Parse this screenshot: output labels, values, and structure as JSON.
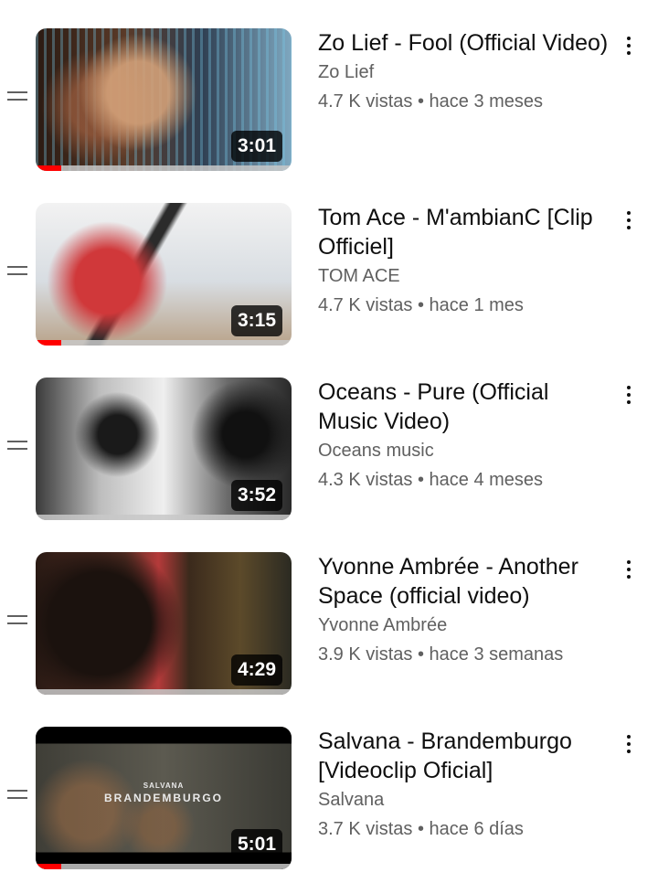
{
  "videos": [
    {
      "title": "Zo Lief - Fool (Official Video)",
      "channel": "Zo Lief",
      "views": "4.7 K vistas",
      "age": "hace 3 meses",
      "duration": "3:01",
      "watched_fraction": 0.1,
      "thumb_caption_small": "",
      "thumb_caption_big": ""
    },
    {
      "title": "Tom Ace - M'ambianC [Clip Officiel]",
      "channel": "TOM ACE",
      "views": "4.7 K vistas",
      "age": "hace 1 mes",
      "duration": "3:15",
      "watched_fraction": 0.1,
      "thumb_caption_small": "",
      "thumb_caption_big": ""
    },
    {
      "title": "Oceans - Pure (Official Music Video)",
      "channel": "Oceans music",
      "views": "4.3 K vistas",
      "age": "hace 4 meses",
      "duration": "3:52",
      "watched_fraction": 0,
      "thumb_caption_small": "",
      "thumb_caption_big": ""
    },
    {
      "title": "Yvonne Ambrée - Another Space (official video)",
      "channel": "Yvonne Ambrée",
      "views": "3.9 K vistas",
      "age": "hace 3 semanas",
      "duration": "4:29",
      "watched_fraction": 0,
      "thumb_caption_small": "",
      "thumb_caption_big": ""
    },
    {
      "title": "Salvana - Brandemburgo [Videoclip Oficial]",
      "channel": "Salvana",
      "views": "3.7 K vistas",
      "age": "hace 6 días",
      "duration": "5:01",
      "watched_fraction": 0.1,
      "thumb_caption_small": "SALVANA",
      "thumb_caption_big": "BRANDEMBURGO"
    }
  ],
  "separator": " • ",
  "icons": {
    "drag": "drag-handle-icon",
    "more": "more-vert-icon"
  },
  "colors": {
    "progress": "#ff0000",
    "text_primary": "#0f0f0f",
    "text_secondary": "#606060"
  }
}
